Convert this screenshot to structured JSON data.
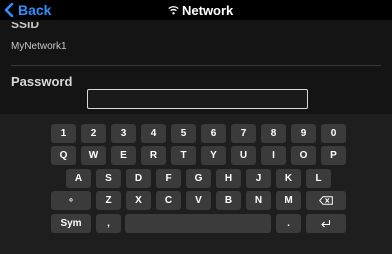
{
  "header": {
    "back_label": "Back",
    "title": "Network",
    "wifi_icon": "wifi-icon",
    "back_icon": "chevron-left-icon",
    "accent_color": "#2f8fff"
  },
  "form": {
    "ssid_label": "SSID",
    "ssid_value": "MyNetwork1",
    "password_label": "Password",
    "password_value": ""
  },
  "keyboard": {
    "number_row": [
      "1",
      "2",
      "3",
      "4",
      "5",
      "6",
      "7",
      "8",
      "9",
      "0"
    ],
    "row_q": [
      "Q",
      "W",
      "E",
      "R",
      "T",
      "Y",
      "U",
      "I",
      "O",
      "P"
    ],
    "row_a": [
      "A",
      "S",
      "D",
      "F",
      "G",
      "H",
      "J",
      "K",
      "L"
    ],
    "row_z": [
      "Z",
      "X",
      "C",
      "V",
      "B",
      "N",
      "M"
    ],
    "shift_symbol": "∘",
    "backspace_icon": "backspace-icon",
    "sym_label": "Sym",
    "comma_label": ",",
    "period_label": ".",
    "enter_icon": "enter-icon"
  }
}
